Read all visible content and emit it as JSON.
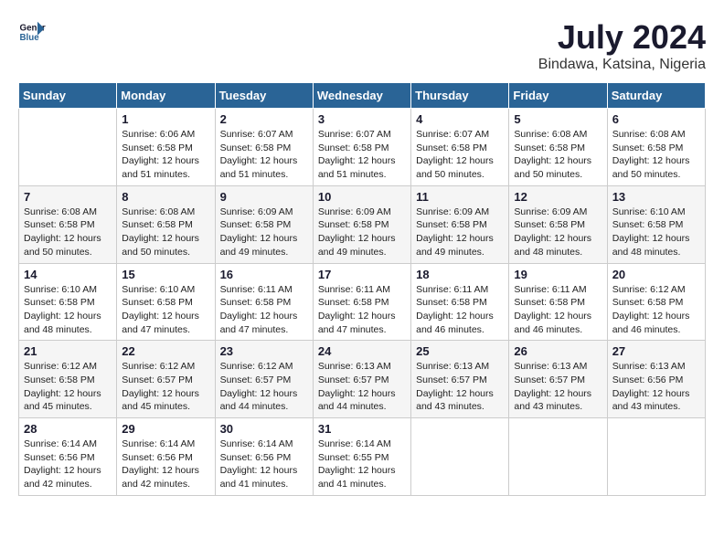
{
  "header": {
    "logo_line1": "General",
    "logo_line2": "Blue",
    "title": "July 2024",
    "location": "Bindawa, Katsina, Nigeria"
  },
  "weekdays": [
    "Sunday",
    "Monday",
    "Tuesday",
    "Wednesday",
    "Thursday",
    "Friday",
    "Saturday"
  ],
  "weeks": [
    [
      {
        "day": "",
        "sunrise": "",
        "sunset": "",
        "daylight": ""
      },
      {
        "day": "1",
        "sunrise": "Sunrise: 6:06 AM",
        "sunset": "Sunset: 6:58 PM",
        "daylight": "Daylight: 12 hours and 51 minutes."
      },
      {
        "day": "2",
        "sunrise": "Sunrise: 6:07 AM",
        "sunset": "Sunset: 6:58 PM",
        "daylight": "Daylight: 12 hours and 51 minutes."
      },
      {
        "day": "3",
        "sunrise": "Sunrise: 6:07 AM",
        "sunset": "Sunset: 6:58 PM",
        "daylight": "Daylight: 12 hours and 51 minutes."
      },
      {
        "day": "4",
        "sunrise": "Sunrise: 6:07 AM",
        "sunset": "Sunset: 6:58 PM",
        "daylight": "Daylight: 12 hours and 50 minutes."
      },
      {
        "day": "5",
        "sunrise": "Sunrise: 6:08 AM",
        "sunset": "Sunset: 6:58 PM",
        "daylight": "Daylight: 12 hours and 50 minutes."
      },
      {
        "day": "6",
        "sunrise": "Sunrise: 6:08 AM",
        "sunset": "Sunset: 6:58 PM",
        "daylight": "Daylight: 12 hours and 50 minutes."
      }
    ],
    [
      {
        "day": "7",
        "sunrise": "Sunrise: 6:08 AM",
        "sunset": "Sunset: 6:58 PM",
        "daylight": "Daylight: 12 hours and 50 minutes."
      },
      {
        "day": "8",
        "sunrise": "Sunrise: 6:08 AM",
        "sunset": "Sunset: 6:58 PM",
        "daylight": "Daylight: 12 hours and 50 minutes."
      },
      {
        "day": "9",
        "sunrise": "Sunrise: 6:09 AM",
        "sunset": "Sunset: 6:58 PM",
        "daylight": "Daylight: 12 hours and 49 minutes."
      },
      {
        "day": "10",
        "sunrise": "Sunrise: 6:09 AM",
        "sunset": "Sunset: 6:58 PM",
        "daylight": "Daylight: 12 hours and 49 minutes."
      },
      {
        "day": "11",
        "sunrise": "Sunrise: 6:09 AM",
        "sunset": "Sunset: 6:58 PM",
        "daylight": "Daylight: 12 hours and 49 minutes."
      },
      {
        "day": "12",
        "sunrise": "Sunrise: 6:09 AM",
        "sunset": "Sunset: 6:58 PM",
        "daylight": "Daylight: 12 hours and 48 minutes."
      },
      {
        "day": "13",
        "sunrise": "Sunrise: 6:10 AM",
        "sunset": "Sunset: 6:58 PM",
        "daylight": "Daylight: 12 hours and 48 minutes."
      }
    ],
    [
      {
        "day": "14",
        "sunrise": "Sunrise: 6:10 AM",
        "sunset": "Sunset: 6:58 PM",
        "daylight": "Daylight: 12 hours and 48 minutes."
      },
      {
        "day": "15",
        "sunrise": "Sunrise: 6:10 AM",
        "sunset": "Sunset: 6:58 PM",
        "daylight": "Daylight: 12 hours and 47 minutes."
      },
      {
        "day": "16",
        "sunrise": "Sunrise: 6:11 AM",
        "sunset": "Sunset: 6:58 PM",
        "daylight": "Daylight: 12 hours and 47 minutes."
      },
      {
        "day": "17",
        "sunrise": "Sunrise: 6:11 AM",
        "sunset": "Sunset: 6:58 PM",
        "daylight": "Daylight: 12 hours and 47 minutes."
      },
      {
        "day": "18",
        "sunrise": "Sunrise: 6:11 AM",
        "sunset": "Sunset: 6:58 PM",
        "daylight": "Daylight: 12 hours and 46 minutes."
      },
      {
        "day": "19",
        "sunrise": "Sunrise: 6:11 AM",
        "sunset": "Sunset: 6:58 PM",
        "daylight": "Daylight: 12 hours and 46 minutes."
      },
      {
        "day": "20",
        "sunrise": "Sunrise: 6:12 AM",
        "sunset": "Sunset: 6:58 PM",
        "daylight": "Daylight: 12 hours and 46 minutes."
      }
    ],
    [
      {
        "day": "21",
        "sunrise": "Sunrise: 6:12 AM",
        "sunset": "Sunset: 6:58 PM",
        "daylight": "Daylight: 12 hours and 45 minutes."
      },
      {
        "day": "22",
        "sunrise": "Sunrise: 6:12 AM",
        "sunset": "Sunset: 6:57 PM",
        "daylight": "Daylight: 12 hours and 45 minutes."
      },
      {
        "day": "23",
        "sunrise": "Sunrise: 6:12 AM",
        "sunset": "Sunset: 6:57 PM",
        "daylight": "Daylight: 12 hours and 44 minutes."
      },
      {
        "day": "24",
        "sunrise": "Sunrise: 6:13 AM",
        "sunset": "Sunset: 6:57 PM",
        "daylight": "Daylight: 12 hours and 44 minutes."
      },
      {
        "day": "25",
        "sunrise": "Sunrise: 6:13 AM",
        "sunset": "Sunset: 6:57 PM",
        "daylight": "Daylight: 12 hours and 43 minutes."
      },
      {
        "day": "26",
        "sunrise": "Sunrise: 6:13 AM",
        "sunset": "Sunset: 6:57 PM",
        "daylight": "Daylight: 12 hours and 43 minutes."
      },
      {
        "day": "27",
        "sunrise": "Sunrise: 6:13 AM",
        "sunset": "Sunset: 6:56 PM",
        "daylight": "Daylight: 12 hours and 43 minutes."
      }
    ],
    [
      {
        "day": "28",
        "sunrise": "Sunrise: 6:14 AM",
        "sunset": "Sunset: 6:56 PM",
        "daylight": "Daylight: 12 hours and 42 minutes."
      },
      {
        "day": "29",
        "sunrise": "Sunrise: 6:14 AM",
        "sunset": "Sunset: 6:56 PM",
        "daylight": "Daylight: 12 hours and 42 minutes."
      },
      {
        "day": "30",
        "sunrise": "Sunrise: 6:14 AM",
        "sunset": "Sunset: 6:56 PM",
        "daylight": "Daylight: 12 hours and 41 minutes."
      },
      {
        "day": "31",
        "sunrise": "Sunrise: 6:14 AM",
        "sunset": "Sunset: 6:55 PM",
        "daylight": "Daylight: 12 hours and 41 minutes."
      },
      {
        "day": "",
        "sunrise": "",
        "sunset": "",
        "daylight": ""
      },
      {
        "day": "",
        "sunrise": "",
        "sunset": "",
        "daylight": ""
      },
      {
        "day": "",
        "sunrise": "",
        "sunset": "",
        "daylight": ""
      }
    ]
  ]
}
